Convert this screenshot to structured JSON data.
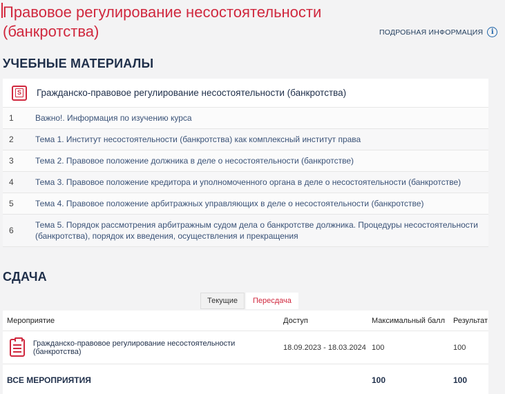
{
  "page": {
    "title": "Правовое регулирование несостоятельности (банкротства)",
    "more_info_label": "ПОДРОБНАЯ ИНФОРМАЦИЯ",
    "info_icon_glyph": "i"
  },
  "materials": {
    "heading": "УЧЕБНЫЕ МАТЕРИАЛЫ",
    "course_title": "Гражданско-правовое регулирование несостоятельности (банкротства)",
    "course_icon_glyph": "S",
    "topics": [
      {
        "num": "1",
        "title": "Важно!. Информация по изучению курса"
      },
      {
        "num": "2",
        "title": "Тема 1. Институт несостоятельности (банкротства) как комплексный институт права"
      },
      {
        "num": "3",
        "title": "Тема 2. Правовое положение должника в деле о несостоятельности (банкротстве)"
      },
      {
        "num": "4",
        "title": "Тема 3. Правовое положение кредитора и уполномоченного органа в деле о несостоятельности (банкротстве)"
      },
      {
        "num": "5",
        "title": "Тема 4. Правовое положение арбитражных управляющих в деле о несостоятельности (банкротстве)"
      },
      {
        "num": "6",
        "title": "Тема 5. Порядок рассмотрения арбитражным судом дела о банкротстве должника. Процедуры несостоятельности (банкротства), порядок их введения, осуществления и прекращения"
      }
    ]
  },
  "submission": {
    "heading": "СДАЧА",
    "tabs": [
      "Текущие",
      "Пересдача"
    ],
    "active_tab": "Пересдача",
    "columns": {
      "event": "Мероприятие",
      "access": "Доступ",
      "max_score": "Максимальный балл",
      "result": "Результат"
    },
    "rows": [
      {
        "event": "Гражданско-правовое регулирование несостоятельности (банкротства)",
        "access": "18.09.2023 - 18.03.2024",
        "max_score": "100",
        "result": "100"
      }
    ],
    "total": {
      "label": "ВСЕ МЕРОПРИЯТИЯ",
      "max_score": "100",
      "result": "100"
    }
  },
  "colors": {
    "accent": "#d0283e",
    "heading": "#1f2f4a",
    "link": "#3a5277",
    "background": "#f3f3f4"
  }
}
